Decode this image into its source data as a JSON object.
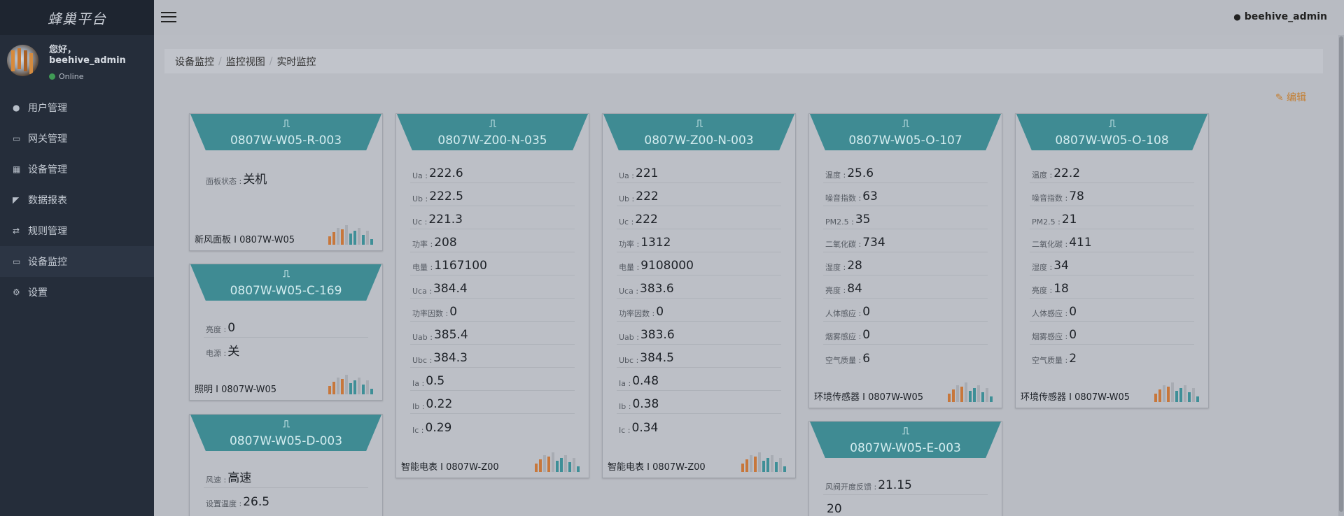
{
  "brand": "蜂巢平台",
  "user": {
    "greeting": "您好，",
    "name": "beehive_admin",
    "status": "Online"
  },
  "menu": [
    {
      "icon": "user-icon",
      "label": "用户管理"
    },
    {
      "icon": "desktop-icon",
      "label": "网关管理"
    },
    {
      "icon": "table-icon",
      "label": "设备管理"
    },
    {
      "icon": "area-chart-icon",
      "label": "数据报表"
    },
    {
      "icon": "exchange-icon",
      "label": "规则管理"
    },
    {
      "icon": "desktop-icon",
      "label": "设备监控",
      "active": true
    },
    {
      "icon": "cogs-icon",
      "label": "设置"
    }
  ],
  "header": {
    "username": "beehive_admin"
  },
  "breadcrumb": [
    "设备监控",
    "监控视图",
    "实时监控"
  ],
  "edit_label": "编辑",
  "colors": {
    "accent": "#3f8b93",
    "edit": "#c47d2e",
    "sidebar": "#252d3a"
  },
  "cards": [
    {
      "title": "0807W-W05-R-003",
      "rows": [
        {
          "label": "面板状态 : ",
          "value": "关机"
        }
      ],
      "footer": "新风面板 I 0807W-W05"
    },
    {
      "title": "0807W-W05-C-169",
      "rows": [
        {
          "label": "亮度 : ",
          "value": "0"
        },
        {
          "label": "电源 : ",
          "value": "关"
        }
      ],
      "footer": "照明 I 0807W-W05"
    },
    {
      "title": "0807W-W05-D-003",
      "rows": [
        {
          "label": "风速 : ",
          "value": "高速"
        },
        {
          "label": "设置温度 : ",
          "value": "26.5"
        }
      ],
      "footer": ""
    },
    {
      "title": "0807W-Z00-N-035",
      "rows": [
        {
          "label": "Ua : ",
          "value": "222.6"
        },
        {
          "label": "Ub : ",
          "value": "222.5"
        },
        {
          "label": "Uc : ",
          "value": "221.3"
        },
        {
          "label": "功率 : ",
          "value": "208"
        },
        {
          "label": "电量 : ",
          "value": "1167100"
        },
        {
          "label": "Uca : ",
          "value": "384.4"
        },
        {
          "label": "功率因数 : ",
          "value": "0"
        },
        {
          "label": "Uab : ",
          "value": "385.4"
        },
        {
          "label": "Ubc : ",
          "value": "384.3"
        },
        {
          "label": "Ia : ",
          "value": "0.5"
        },
        {
          "label": "Ib : ",
          "value": "0.22"
        },
        {
          "label": "Ic : ",
          "value": "0.29"
        }
      ],
      "footer": "智能电表 I 0807W-Z00"
    },
    {
      "title": "0807W-Z00-N-003",
      "rows": [
        {
          "label": "Ua : ",
          "value": "221"
        },
        {
          "label": "Ub : ",
          "value": "222"
        },
        {
          "label": "Uc : ",
          "value": "222"
        },
        {
          "label": "功率 : ",
          "value": "1312"
        },
        {
          "label": "电量 : ",
          "value": "9108000"
        },
        {
          "label": "Uca : ",
          "value": "383.6"
        },
        {
          "label": "功率因数 : ",
          "value": "0"
        },
        {
          "label": "Uab : ",
          "value": "383.6"
        },
        {
          "label": "Ubc : ",
          "value": "384.5"
        },
        {
          "label": "Ia : ",
          "value": "0.48"
        },
        {
          "label": "Ib : ",
          "value": "0.38"
        },
        {
          "label": "Ic : ",
          "value": "0.34"
        }
      ],
      "footer": "智能电表 I 0807W-Z00"
    },
    {
      "title": "0807W-W05-O-107",
      "rows": [
        {
          "label": "温度 : ",
          "value": "25.6"
        },
        {
          "label": "噪音指数 : ",
          "value": "63"
        },
        {
          "label": "PM2.5 : ",
          "value": "35"
        },
        {
          "label": "二氧化碳 : ",
          "value": "734"
        },
        {
          "label": "湿度 : ",
          "value": "28"
        },
        {
          "label": "亮度 : ",
          "value": "84"
        },
        {
          "label": "人体感应 : ",
          "value": "0"
        },
        {
          "label": "烟雾感应 : ",
          "value": "0"
        },
        {
          "label": "空气质量 : ",
          "value": "6"
        }
      ],
      "footer": "环境传感器 I 0807W-W05"
    },
    {
      "title": "0807W-W05-E-003",
      "rows": [
        {
          "label": "风阀开度反馈 : ",
          "value": "21.15"
        },
        {
          "label": "",
          "value": "20"
        }
      ],
      "footer": ""
    },
    {
      "title": "0807W-W05-O-108",
      "rows": [
        {
          "label": "温度 : ",
          "value": "22.2"
        },
        {
          "label": "噪音指数 : ",
          "value": "78"
        },
        {
          "label": "PM2.5 : ",
          "value": "21"
        },
        {
          "label": "二氧化碳 : ",
          "value": "411"
        },
        {
          "label": "湿度 : ",
          "value": "34"
        },
        {
          "label": "亮度 : ",
          "value": "18"
        },
        {
          "label": "人体感应 : ",
          "value": "0"
        },
        {
          "label": "烟雾感应 : ",
          "value": "0"
        },
        {
          "label": "空气质量 : ",
          "value": "2"
        }
      ],
      "footer": "环境传感器 I 0807W-W05"
    }
  ]
}
